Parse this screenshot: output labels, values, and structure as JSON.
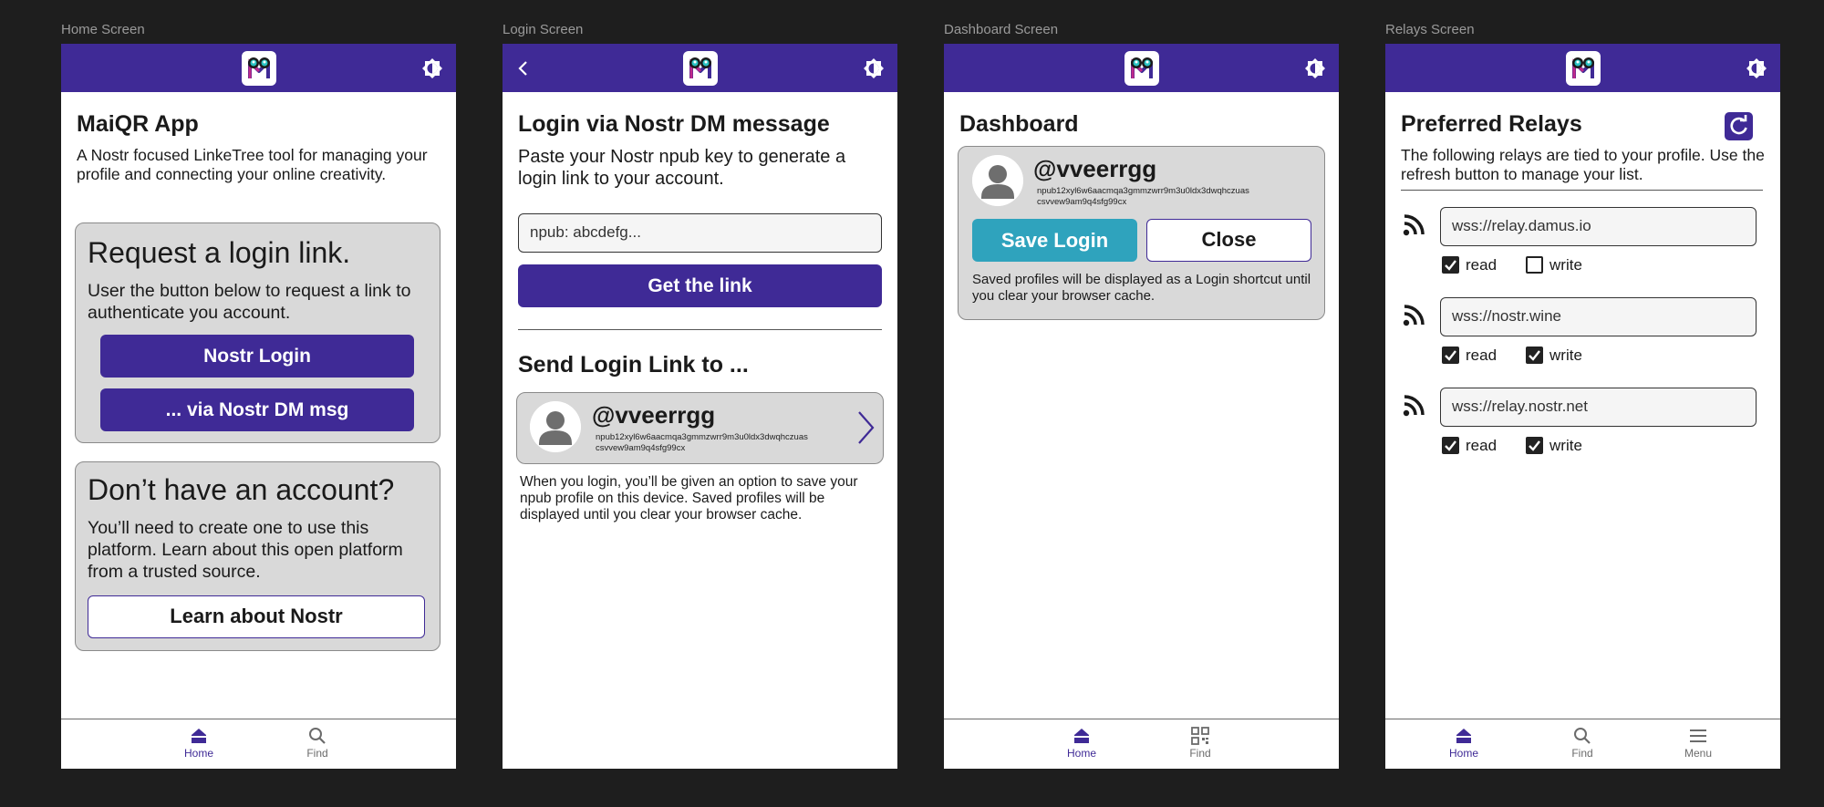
{
  "screens": {
    "home": {
      "frame_label": "Home Screen",
      "title": "MaiQR App",
      "description": "A Nostr focused LinkeTree tool for managing your profile and connecting your online creativity.",
      "request_card": {
        "heading": "Request a login link.",
        "text": "User the button below to request a link to authenticate you account.",
        "button_login": "Nostr Login",
        "button_dm": "... via Nostr DM msg"
      },
      "account_card": {
        "heading": "Don’t have an account?",
        "text": "You’ll need to create one to use this platform. Learn about this open platform from a trusted source.",
        "button": "Learn about Nostr"
      },
      "nav": {
        "home": "Home",
        "find": "Find"
      }
    },
    "login": {
      "frame_label": "Login Screen",
      "title": "Login via Nostr DM message",
      "subtitle": "Paste your Nostr npub key to generate a login link to your account.",
      "input_placeholder": "npub: abcdefg...",
      "button": "Get the link",
      "send_heading": "Send Login Link to ...",
      "profile": {
        "handle": "@vveerrgg",
        "npub": "npub12xyl6w6aacmqa3gmmzwrr9m3u0ldx3dwqhczuas csvvew9am9q4sfg99cx"
      },
      "note": "When you login, you’ll be given an option to save your npub profile on this device. Saved profiles will be displayed until you clear your browser cache."
    },
    "dashboard": {
      "frame_label": "Dashboard Screen",
      "title": "Dashboard",
      "profile": {
        "handle": "@vveerrgg",
        "npub": "npub12xyl6w6aacmqa3gmmzwrr9m3u0ldx3dwqhczuas csvvew9am9q4sfg99cx"
      },
      "save_button": "Save Login",
      "close_button": "Close",
      "note": "Saved profiles will be displayed as a Login shortcut until you clear your browser cache.",
      "nav": {
        "home": "Home",
        "find": "Find"
      }
    },
    "relays": {
      "frame_label": "Relays Screen",
      "title": "Preferred Relays",
      "description": "The following relays are tied to your profile. Use the refresh button to manage your list.",
      "relays": [
        {
          "url": "wss://relay.damus.io",
          "read": true,
          "write": false
        },
        {
          "url": "wss://nostr.wine",
          "read": true,
          "write": true
        },
        {
          "url": "wss://relay.nostr.net",
          "read": true,
          "write": true
        }
      ],
      "read_label": "read",
      "write_label": "write",
      "nav": {
        "home": "Home",
        "find": "Find",
        "menu": "Menu"
      }
    }
  },
  "colors": {
    "brand": "#3f2a96",
    "teal": "#2fa3bd",
    "card": "#d9d9d9",
    "background": "#1e1e1e"
  },
  "icons": [
    "app-logo-icon",
    "theme-toggle-icon",
    "back-arrow-icon",
    "home-icon",
    "search-icon",
    "qr-code-icon",
    "menu-icon",
    "user-avatar-icon",
    "chevron-right-icon",
    "refresh-icon",
    "rss-icon",
    "checkbox-check-icon"
  ]
}
